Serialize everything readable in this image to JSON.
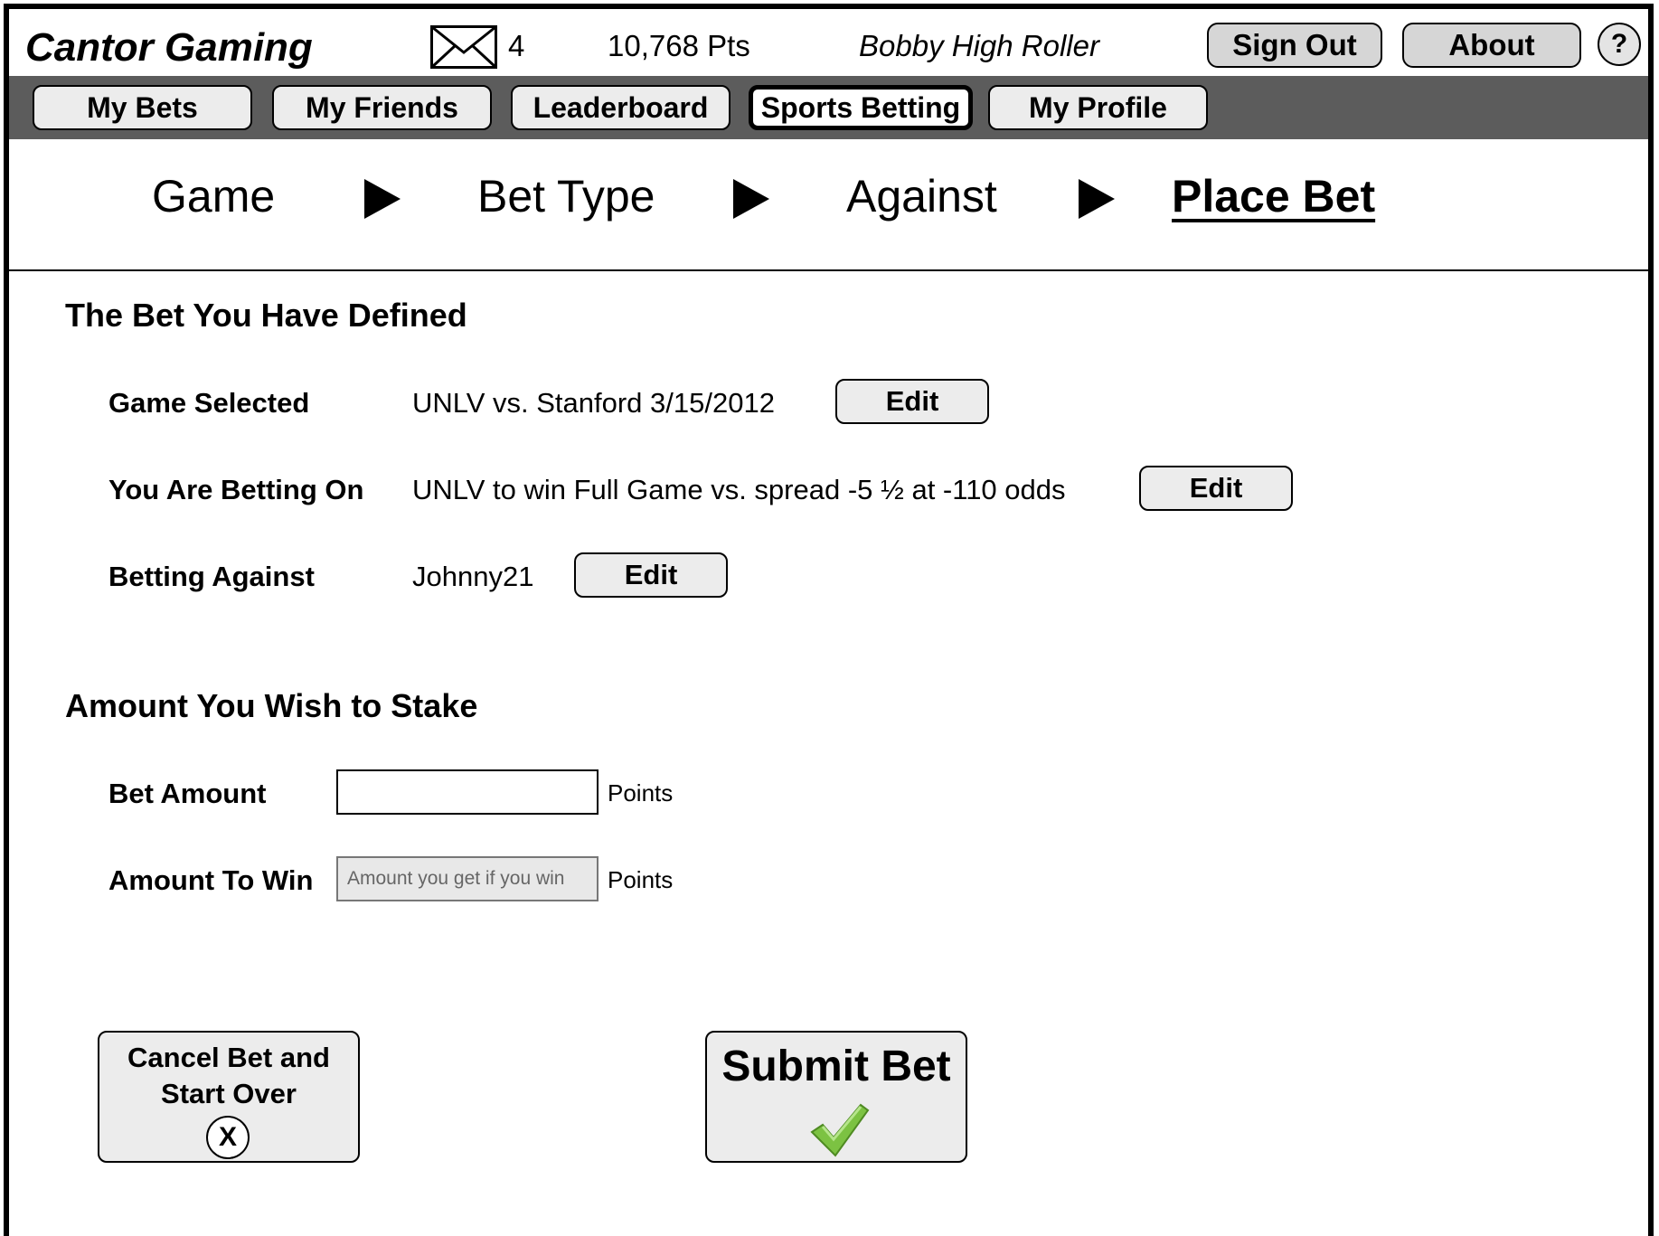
{
  "header": {
    "brand": "Cantor Gaming",
    "message_count": "4",
    "points": "10,768 Pts",
    "username": "Bobby High Roller",
    "sign_out": "Sign Out",
    "about": "About",
    "help": "?"
  },
  "nav": {
    "tabs": [
      {
        "label": "My Bets"
      },
      {
        "label": "My Friends"
      },
      {
        "label": "Leaderboard"
      },
      {
        "label": "Sports Betting"
      },
      {
        "label": "My Profile"
      }
    ],
    "active": "Sports Betting"
  },
  "steps": [
    {
      "label": "Game"
    },
    {
      "label": "Bet Type"
    },
    {
      "label": "Against"
    },
    {
      "label": "Place Bet"
    }
  ],
  "bet_defined": {
    "title": "The Bet You Have Defined",
    "game_label": "Game Selected",
    "game_value": "UNLV vs. Stanford 3/15/2012",
    "betting_on_label": "You Are Betting On",
    "betting_on_value": "UNLV to win Full Game vs. spread -5 ½ at -110 odds",
    "against_label": "Betting Against",
    "against_value": "Johnny21",
    "edit_label": "Edit"
  },
  "stake": {
    "title": "Amount You Wish to Stake",
    "bet_amount_label": "Bet Amount",
    "bet_amount_value": "",
    "amount_to_win_label": "Amount To Win",
    "amount_to_win_placeholder": "Amount you get if you win",
    "unit": "Points"
  },
  "actions": {
    "cancel_label": "Cancel Bet and Start Over",
    "cancel_icon": "X",
    "submit_label": "Submit Bet"
  },
  "colors": {
    "nav_bg": "#5c5c5c",
    "button_bg": "#ececec",
    "check_green": "#7cc242"
  }
}
